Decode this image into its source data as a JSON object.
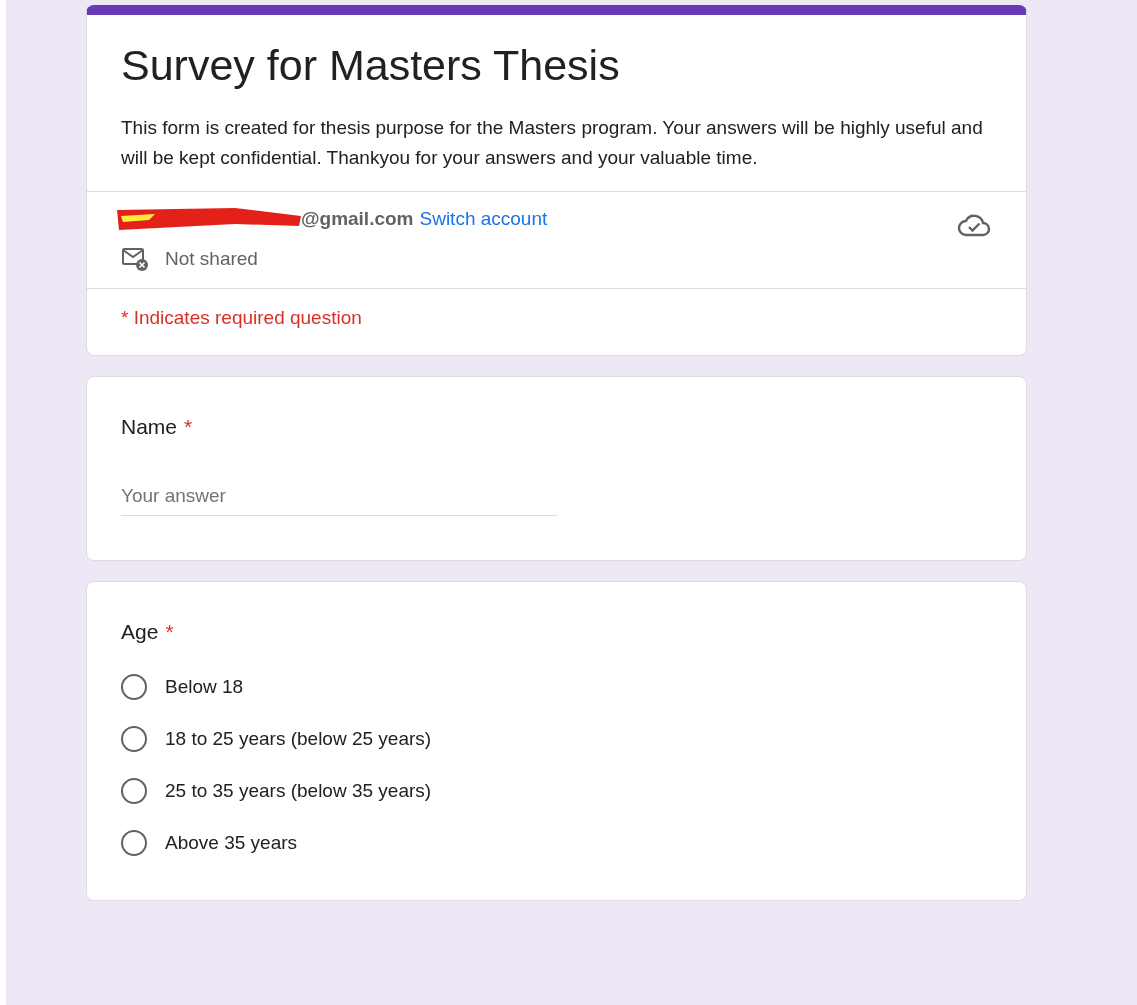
{
  "form": {
    "title": "Survey for Masters Thesis",
    "description": "This form is created for thesis purpose for the Masters program. Your answers will be highly useful and will be kept confidential. Thankyou for your answers and your valuable time."
  },
  "account": {
    "email": "@gmail.com",
    "redacted": true,
    "switch_link": "Switch account",
    "sharing": "Not shared"
  },
  "required_note": "* Indicates required question",
  "questions": [
    {
      "kind": "text",
      "title": "Name",
      "required_mark": "*",
      "placeholder": "Your answer"
    },
    {
      "kind": "radio",
      "title": "Age",
      "required_mark": "*",
      "options": [
        {
          "label": "Below 18",
          "selected": false
        },
        {
          "label": "18 to 25 years (below 25 years)",
          "selected": false
        },
        {
          "label": "25 to 35 years (below 35 years)",
          "selected": false
        },
        {
          "label": "Above 35 years",
          "selected": false
        }
      ]
    }
  ]
}
